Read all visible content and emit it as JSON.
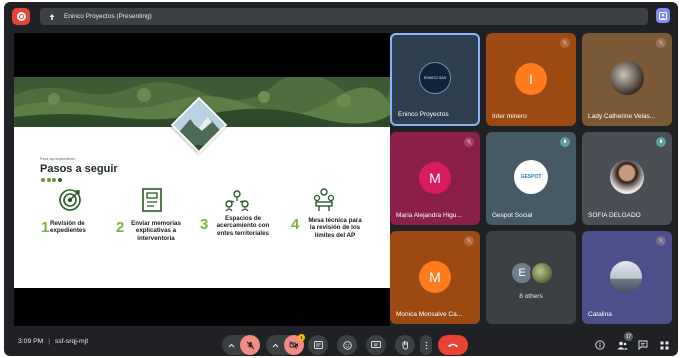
{
  "meeting": {
    "presenting_label": "Eninco Proyectos (Presenting)",
    "time": "3:09 PM",
    "code": "ssf-srqj-mjt",
    "participant_count": "17",
    "reactions_badge": "1"
  },
  "slide": {
    "kicker": "Fase Aprestamiento",
    "title": "Pasos a seguir",
    "steps": [
      {
        "number": "1",
        "lines": [
          "Revisión de",
          "expedientes"
        ]
      },
      {
        "number": "2",
        "lines": [
          "Enviar memorias",
          "explicativas a",
          "interventoria"
        ]
      },
      {
        "number": "3",
        "lines": [
          "Espacios de",
          "acercamiento con",
          "entes territoriales"
        ]
      },
      {
        "number": "4",
        "lines": [
          "Mesa técnica para",
          "la revisión de los",
          "límites del AP"
        ]
      }
    ]
  },
  "tiles": [
    {
      "name": "Eninco Proyectos",
      "kind": "logo",
      "logo_text": "ENINCO SAS"
    },
    {
      "name": "Inter minero",
      "initial": "I",
      "bg": "#9c4a12",
      "avatar": "#ff7b1c"
    },
    {
      "name": "Lady Catherine Velas...",
      "kind": "photo"
    },
    {
      "name": "Maria Alejandra Higu...",
      "initial": "M",
      "bg": "#8a1f4a",
      "avatar": "#d81b60"
    },
    {
      "name": "Gespot Social",
      "kind": "logo",
      "logo_text": "GESPOT"
    },
    {
      "name": "SOFIA DELGADO",
      "kind": "photo"
    },
    {
      "name": "Monica Monsalve Ca...",
      "initial": "M",
      "bg": "#9c4a12",
      "avatar": "#ff7b1c"
    },
    {
      "name": "8 others",
      "kind": "others",
      "initial": "E"
    },
    {
      "name": "Catalina",
      "kind": "photo"
    }
  ],
  "colors": {
    "record": "#ea4335",
    "end_call": "#ea4335",
    "muted_control": "#f28b82",
    "slide_accent": "#7fb241"
  },
  "icons": [
    "record-icon",
    "present-icon",
    "self-view-icon",
    "mic-off-icon",
    "camera-off-icon",
    "captions-icon",
    "emoji-icon",
    "present-screen-icon",
    "raise-hand-icon",
    "more-icon",
    "end-call-icon",
    "info-icon",
    "people-icon",
    "chat-icon",
    "activities-icon"
  ]
}
